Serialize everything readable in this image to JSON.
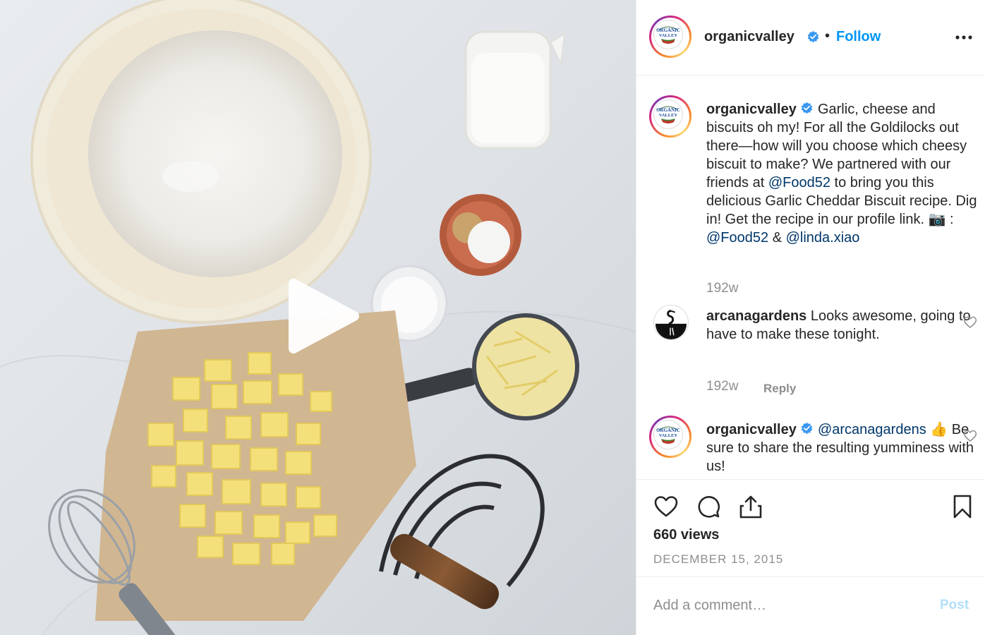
{
  "post": {
    "media_type": "video",
    "play_icon": "play-icon"
  },
  "header": {
    "username": "organicvalley",
    "verified": true,
    "dot": "•",
    "follow_label": "Follow",
    "more_icon": "more-horizontal-icon"
  },
  "brand_logo_text": [
    "ORGANIC",
    "VALLEY"
  ],
  "caption": {
    "username": "organicvalley",
    "parts": [
      "Garlic, cheese and biscuits oh my! For all the Goldilocks out there—how will you choose which cheesy biscuit to make? We partnered with our friends at ",
      "@Food52",
      " to bring you this delicious Garlic Cheddar Biscuit recipe. Dig in! Get the recipe in our profile link. 📷 : ",
      "@Food52",
      " & ",
      "@linda.xiao"
    ],
    "time": "192w"
  },
  "comments": [
    {
      "username": "arcanagardens",
      "text": "Looks awesome, going to have to make these tonight.",
      "time": "192w",
      "reply_label": "Reply"
    },
    {
      "username": "organicvalley",
      "mention": "@arcanagardens",
      "text": "👍 Be sure to share the resulting yumminess with us!"
    }
  ],
  "actions": {
    "like_icon": "heart-icon",
    "comment_icon": "comment-icon",
    "share_icon": "share-icon",
    "save_icon": "bookmark-icon"
  },
  "views": "660 views",
  "date": "DECEMBER 15, 2015",
  "comment_box": {
    "placeholder": "Add a comment…",
    "post_label": "Post"
  },
  "colors": {
    "link": "#0095f6",
    "mention": "#00376b",
    "muted": "#8e8e8e",
    "post_disabled": "#b2dffc"
  }
}
